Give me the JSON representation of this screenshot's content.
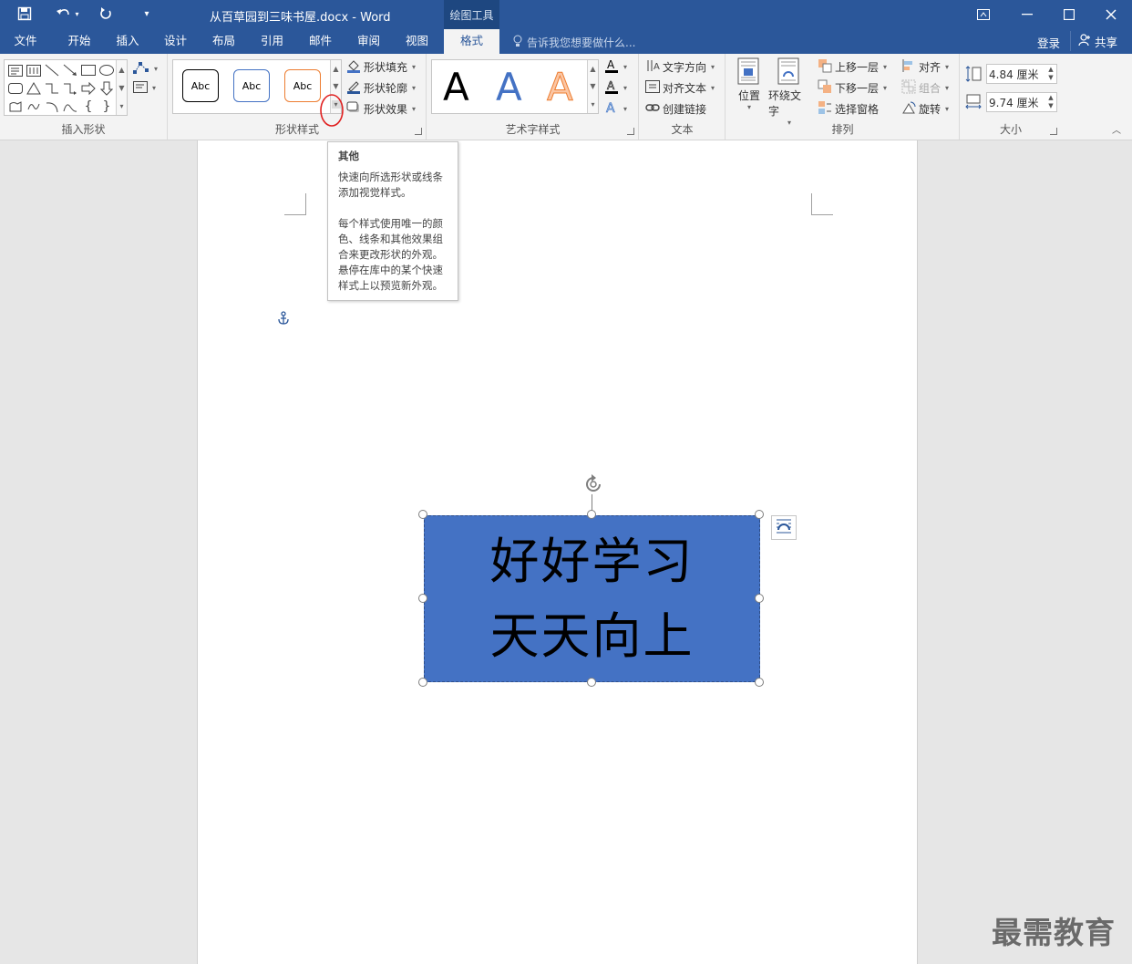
{
  "title_bar": {
    "document_title": "从百草园到三味书屋.docx - Word",
    "context_tab_header": "绘图工具",
    "quick_access": [
      "save-icon",
      "undo-icon",
      "redo-icon",
      "customize-icon"
    ]
  },
  "menu": {
    "tabs": [
      {
        "label": "文件"
      },
      {
        "label": "开始"
      },
      {
        "label": "插入"
      },
      {
        "label": "设计"
      },
      {
        "label": "布局"
      },
      {
        "label": "引用"
      },
      {
        "label": "邮件"
      },
      {
        "label": "审阅"
      },
      {
        "label": "视图"
      },
      {
        "label": "格式",
        "active": true
      }
    ],
    "tell_me_placeholder": "告诉我您想要做什么...",
    "login_label": "登录",
    "share_label": "共享"
  },
  "ribbon": {
    "insert_shapes": {
      "label": "插入形状"
    },
    "shape_styles": {
      "label": "形状样式",
      "gallery_items": [
        "Abc",
        "Abc",
        "Abc"
      ],
      "fill_label": "形状填充",
      "outline_label": "形状轮廓",
      "effects_label": "形状效果"
    },
    "wordart_styles": {
      "label": "艺术字样式",
      "gallery_items": [
        "A",
        "A",
        "A"
      ]
    },
    "text": {
      "label": "文本",
      "direction_label": "文字方向",
      "align_label": "对齐文本",
      "link_label": "创建链接"
    },
    "arrange": {
      "label": "排列",
      "position_label": "位置",
      "wrap_label": "环绕文字",
      "bring_forward_label": "上移一层",
      "send_backward_label": "下移一层",
      "selection_pane_label": "选择窗格",
      "align_label": "对齐",
      "group_label": "组合",
      "rotate_label": "旋转"
    },
    "size": {
      "label": "大小",
      "height_value": "4.84 厘米",
      "width_value": "9.74 厘米"
    }
  },
  "tooltip": {
    "title": "其他",
    "paragraph1": "快速向所选形状或线条添加视觉样式。",
    "paragraph2": "每个样式使用唯一的颜色、线条和其他效果组合来更改形状的外观。悬停在库中的某个快速样式上以预览新外观。"
  },
  "shape": {
    "line1": "好好学习",
    "line2": "天天向上",
    "fill_color": "#4472c4"
  },
  "watermark": "最需教育",
  "colors": {
    "word_blue": "#2b579a",
    "ribbon_bg": "#f3f3f3",
    "canvas_bg": "#e6e6e6",
    "highlight_circle": "#e02020"
  }
}
